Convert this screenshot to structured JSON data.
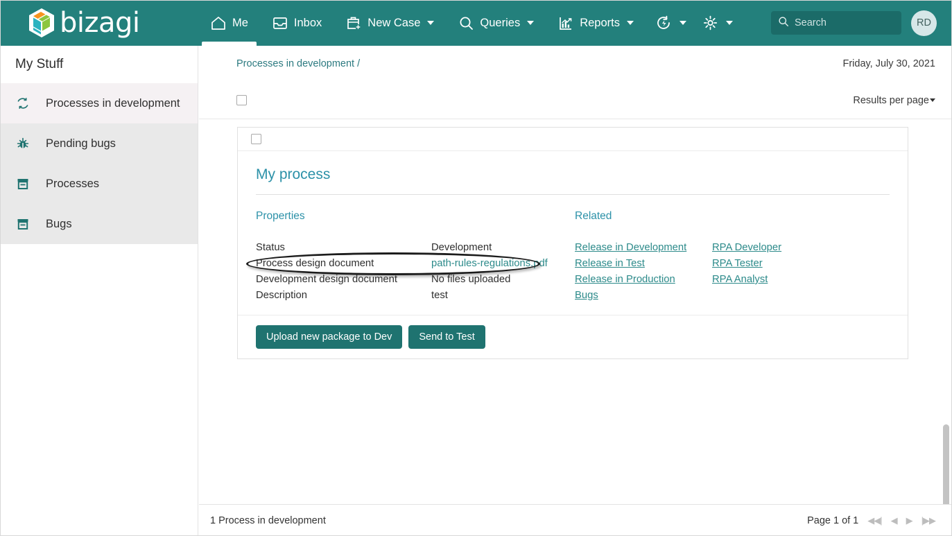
{
  "brand": {
    "name": "bizagi",
    "logo_icon": "bizagi-cube-logo",
    "header_color": "#23807c",
    "accent_color": "#2c91a8",
    "link_color": "#2c8a8a",
    "button_color": "#1f7370"
  },
  "header": {
    "nav": [
      {
        "label": "Me",
        "icon": "home-icon",
        "active": true,
        "dropdown": false
      },
      {
        "label": "Inbox",
        "icon": "inbox-icon",
        "active": false,
        "dropdown": false
      },
      {
        "label": "New Case",
        "icon": "briefcase-plus-icon",
        "active": false,
        "dropdown": true
      },
      {
        "label": "Queries",
        "icon": "search-icon",
        "active": false,
        "dropdown": true
      },
      {
        "label": "Reports",
        "icon": "chart-icon",
        "active": false,
        "dropdown": true
      }
    ],
    "icon_buttons": [
      {
        "icon": "automation-refresh-icon",
        "dropdown": true
      },
      {
        "icon": "gear-icon",
        "dropdown": true
      }
    ],
    "search": {
      "placeholder": "Search",
      "value": "",
      "icon": "search-icon"
    },
    "avatar": {
      "initials": "RD"
    }
  },
  "sidebar": {
    "title": "My Stuff",
    "items": [
      {
        "label": "Processes in development",
        "icon": "sync-icon",
        "selected": true
      },
      {
        "label": "Pending bugs",
        "icon": "bug-icon",
        "selected": false
      },
      {
        "label": "Processes",
        "icon": "archive-box-icon",
        "selected": false
      },
      {
        "label": "Bugs",
        "icon": "archive-box-icon",
        "selected": false
      }
    ]
  },
  "toolbar": {
    "breadcrumb": "Processes in development /",
    "date": "Friday, July 30, 2021",
    "results_per_page": "Results per page",
    "select_all_checked": false
  },
  "card": {
    "row_checked": false,
    "title": "My process",
    "properties": {
      "section_title": "Properties",
      "rows": [
        {
          "key": "Status",
          "value": "Development",
          "is_link": false,
          "highlighted": false
        },
        {
          "key": "Process design document",
          "value": "path-rules-regulations.pdf",
          "is_link": true,
          "highlighted": true
        },
        {
          "key": "Development design document",
          "value": "No files uploaded",
          "is_link": false,
          "highlighted": false
        },
        {
          "key": "Description",
          "value": "test",
          "is_link": false,
          "highlighted": false
        }
      ]
    },
    "related": {
      "section_title": "Related",
      "column_one": [
        "Release in Development",
        "Release in Test",
        "Release in Production",
        "Bugs"
      ],
      "column_two": [
        "RPA Developer",
        "RPA Tester",
        "RPA Analyst"
      ]
    },
    "actions": [
      {
        "label": "Upload new package to Dev"
      },
      {
        "label": "Send to Test"
      }
    ]
  },
  "footer": {
    "count_text": "1 Process  in development",
    "page_label": "Page 1 of 1",
    "pager": [
      {
        "icon": "first-page-icon",
        "glyph": "◀◀|"
      },
      {
        "icon": "prev-page-icon",
        "glyph": "◀"
      },
      {
        "icon": "next-page-icon",
        "glyph": "▶"
      },
      {
        "icon": "last-page-icon",
        "glyph": "|▶▶"
      }
    ]
  }
}
